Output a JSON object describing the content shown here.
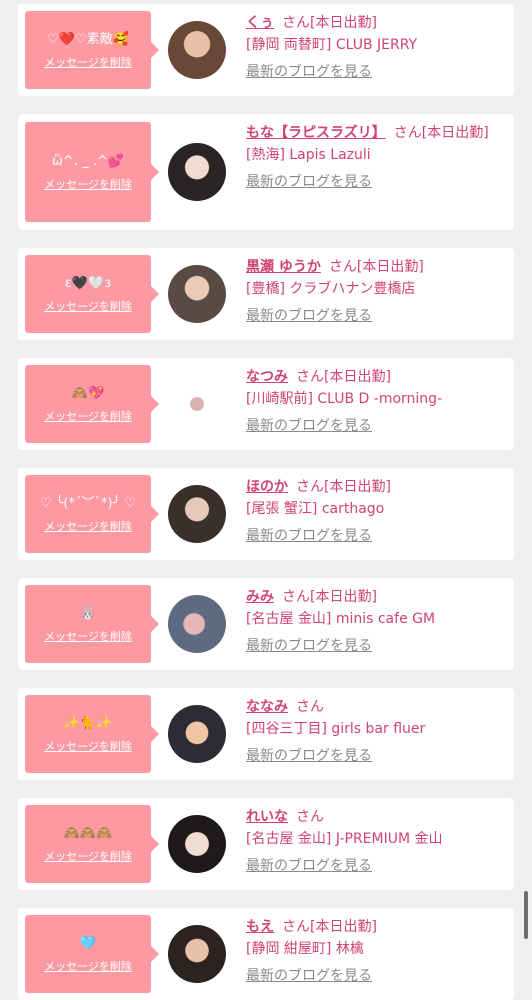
{
  "delete_label": "メッセージを削除",
  "san_label": "さん",
  "blog_label": "最新のブログを見る",
  "cards": [
    {
      "message": "♡❤️♡素敵🥰",
      "name": "くぅ",
      "status": "[本日出勤]",
      "shop": "[静岡 両替町] CLUB JERRY"
    },
    {
      "message": "ὣ^. _ .^💕",
      "name": "もな【ラピスラズリ】",
      "status": "[本日出勤]",
      "shop": "[熱海] Lapis Lazuli"
    },
    {
      "message": "ɛ🖤🤍ɜ",
      "name": "黒瀬 ゆうか",
      "status": "[本日出勤]",
      "shop": "[豊橋] クラブハナン豊橋店"
    },
    {
      "message": "🙈💖",
      "name": "なつみ",
      "status": "[本日出勤]",
      "shop": "[川崎駅前] CLUB D -morning-"
    },
    {
      "message": "♡ ╰(*´︶`*)╯ ♡",
      "name": "ほのか",
      "status": "[本日出勤]",
      "shop": "[尾張 蟹江] carthago"
    },
    {
      "message": "🐰",
      "name": "みみ",
      "status": "[本日出勤]",
      "shop": "[名古屋 金山] minis cafe GM"
    },
    {
      "message": "✨🐈✨",
      "name": "ななみ",
      "status": "",
      "shop": "[四谷三丁目] girls bar fluer"
    },
    {
      "message": "🙈🙈🙈",
      "name": "れいな",
      "status": "",
      "shop": "[名古屋 金山] J-PREMIUM 金山"
    },
    {
      "message": "🩵",
      "name": "もえ",
      "status": "[本日出勤]",
      "shop": "[静岡 紺屋町] 林檎"
    }
  ],
  "colors": {
    "accent": "#d24470",
    "message_bg": "#fc99a2",
    "link_gray": "#8a8a8a"
  }
}
